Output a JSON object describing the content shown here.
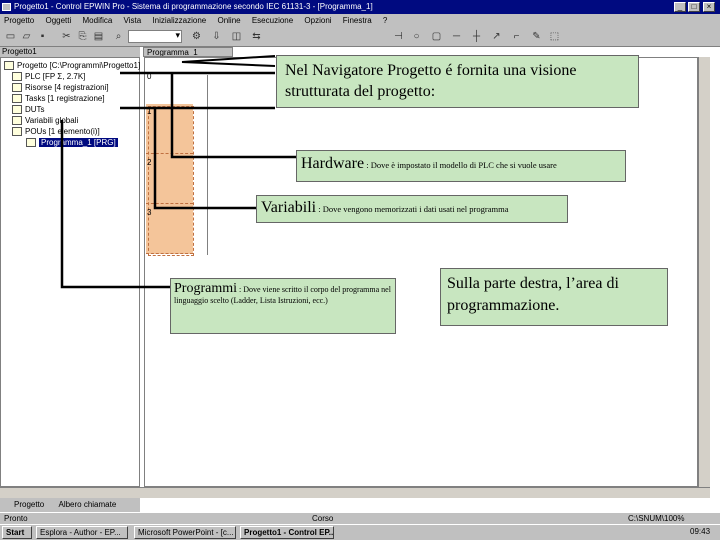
{
  "window": {
    "title": "Progetto1 - Control EPWIN Pro - Sistema di programmazione secondo IEC 61131-3 - [Programma_1]",
    "buttons": [
      "_",
      "□",
      "×"
    ]
  },
  "menu": [
    "Progetto",
    "Oggetti",
    "Modifica",
    "Vista",
    "Inizializzazione",
    "Online",
    "Esecuzione",
    "Opzioni",
    "Finestra",
    "?"
  ],
  "panel": {
    "title": "Progetto1",
    "tree": [
      "Progetto [C:\\Programmi\\Progetto1]",
      "PLC [FP Σ, 2.7K]",
      "Risorse [4 registrazioni]",
      "Tasks [1 registrazione]",
      "DUTs",
      "Variabili globali",
      "POUs [1 elemento(i)]",
      "Programma_1 [PRG]"
    ],
    "tabs": [
      "Progetto",
      "Albero chiamate"
    ]
  },
  "editor": {
    "tab": "Programma_1",
    "rung_numbers": [
      "0",
      "1",
      "2",
      "3"
    ]
  },
  "status": {
    "left": "Pronto",
    "mid": "Corso",
    "right": "C:\\SNUM\\100%"
  },
  "taskbar": {
    "start": "Start",
    "items": [
      "Esplora - Author - EP...",
      "Microsoft PowerPoint - [c...",
      "Progetto1 - Control EP..."
    ],
    "clock": "09:43"
  },
  "callouts": {
    "navigator": "Nel Navigatore Progetto é fornita una visione strutturata del progetto:",
    "hardware_title": "Hardware",
    "hardware_desc": " : Dove è impostato il modello di PLC che si vuole usare",
    "variables_title": "Variabili",
    "variables_desc": " : Dove vengono memorizzati i dati usati nel programma",
    "programs_title": "Programmi",
    "programs_desc": " : Dove viene scritto il corpo del programma nel linguaggio scelto (Ladder, Lista Istruzioni, ecc.)",
    "editor_area": "Sulla parte destra, l’area di programmazione."
  },
  "colors": {
    "title_bar": "#000a80",
    "callout_bg": "#c8e6c0",
    "rung": "#f4c59a"
  }
}
